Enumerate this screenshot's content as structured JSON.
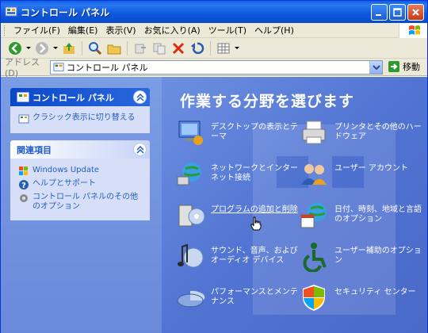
{
  "window": {
    "title": "コントロール パネル",
    "controls": [
      "minimize",
      "maximize",
      "close"
    ]
  },
  "menubar": {
    "items": [
      "ファイル(F)",
      "編集(E)",
      "表示(V)",
      "お気に入り(A)",
      "ツール(T)",
      "ヘルプ(H)"
    ]
  },
  "toolbar": {
    "buttons": [
      "back-icon",
      "forward-icon",
      "up-folder-icon",
      "search-icon",
      "folders-icon",
      "move-to-icon",
      "copy-to-icon",
      "delete-icon",
      "undo-icon",
      "views-icon"
    ]
  },
  "addressbar": {
    "label": "アドレス(D)",
    "value": "コントロール パネル",
    "go_label": "移動"
  },
  "leftpane": {
    "panel_title": "コントロール パネル",
    "switch_link": "クラシック表示に切り替える",
    "related_title": "関連項目",
    "related_links": [
      "Windows Update",
      "ヘルプとサポート",
      "コントロール パネルのその他のオプション"
    ]
  },
  "main": {
    "heading": "作業する分野を選びます",
    "categories": [
      {
        "label": "デスクトップの表示とテーマ",
        "icon": "display-icon"
      },
      {
        "label": "プリンタとその他のハードウェア",
        "icon": "printer-icon"
      },
      {
        "label": "ネットワークとインターネット接続",
        "icon": "network-icon"
      },
      {
        "label": "ユーザー アカウント",
        "icon": "users-icon"
      },
      {
        "label": "プログラムの追加と削除",
        "icon": "add-remove-programs-icon"
      },
      {
        "label": "日付、時刻、地域と言語のオプション",
        "icon": "date-time-icon"
      },
      {
        "label": "サウンド、音声、およびオーディオ デバイス",
        "icon": "sound-icon"
      },
      {
        "label": "ユーザー補助のオプション",
        "icon": "accessibility-icon"
      },
      {
        "label": "パフォーマンスとメンテナンス",
        "icon": "performance-icon"
      },
      {
        "label": "セキュリティ センター",
        "icon": "security-shield-icon"
      }
    ]
  },
  "colors": {
    "titlebar": "#0a5fe6",
    "menubar_bg": "#ece9d8",
    "left_pane": "#7b9de4",
    "right_pane": "#5174d3",
    "link": "#215dc6"
  }
}
